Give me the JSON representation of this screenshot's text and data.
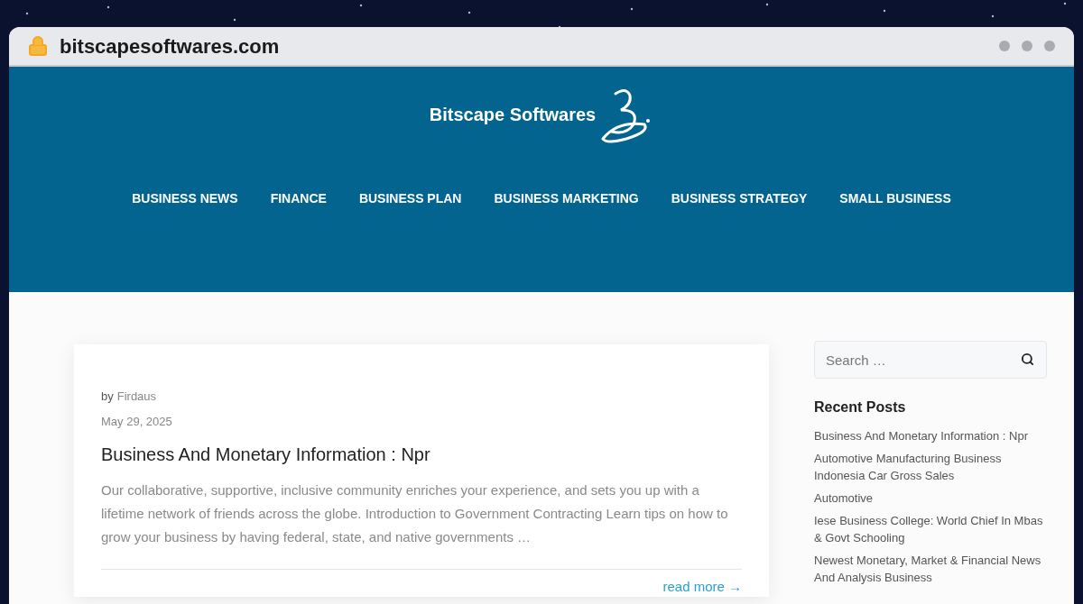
{
  "browser": {
    "address": "bitscapesoftwares.com"
  },
  "site": {
    "logo_text": "Bitscape Softwares",
    "nav": [
      {
        "label": "BUSINESS NEWS"
      },
      {
        "label": "FINANCE"
      },
      {
        "label": "BUSINESS PLAN"
      },
      {
        "label": "BUSINESS MARKETING"
      },
      {
        "label": "BUSINESS STRATEGY"
      },
      {
        "label": "SMALL BUSINESS"
      }
    ]
  },
  "post": {
    "by": "by",
    "author": "Firdaus",
    "date": "May 29, 2025",
    "title": "Business And Monetary Information : Npr",
    "excerpt": "Our collaborative, supportive, inclusive community enriches your experience, and sets you up with a lifetime network of friends across the globe. Introduction to Government Contracting Learn tips on how to grow your business by having federal, state, and native governments …",
    "read_more": "read more →"
  },
  "sidebar": {
    "search": {
      "placeholder": "Search …"
    },
    "recent_title": "Recent Posts",
    "recent_posts": [
      "Business And Monetary Information : Npr",
      "Automotive Manufacturing Business Indonesia Car Gross Sales",
      "Automotive",
      "Iese Business College: World Chief In Mbas & Govt Schooling",
      "Newest Monetary, Market & Financial News And Analysis Business"
    ]
  }
}
